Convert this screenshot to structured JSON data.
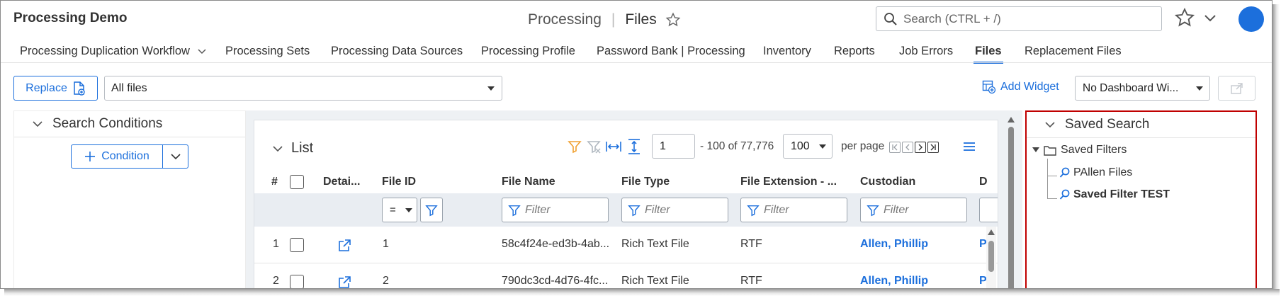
{
  "app": {
    "title": "Processing Demo"
  },
  "breadcrumb": {
    "parent": "Processing",
    "current": "Files"
  },
  "search": {
    "placeholder": "Search (CTRL + /)"
  },
  "tabs": [
    {
      "label": "Processing Duplication Workflow",
      "has_dropdown": true
    },
    {
      "label": "Processing Sets"
    },
    {
      "label": "Processing Data Sources"
    },
    {
      "label": "Processing Profile"
    },
    {
      "label": "Password Bank | Processing"
    },
    {
      "label": "Inventory"
    },
    {
      "label": "Reports"
    },
    {
      "label": "Job Errors"
    },
    {
      "label": "Files",
      "active": true
    },
    {
      "label": "Replacement Files"
    }
  ],
  "toolbar": {
    "replace_label": "Replace",
    "view_select": "All files",
    "add_widget_label": "Add Widget",
    "dashboard_select": "No Dashboard Wi..."
  },
  "search_conditions": {
    "title": "Search Conditions",
    "condition_label": "Condition"
  },
  "list": {
    "title": "List",
    "page": "1",
    "range_text": "- 100 of 77,776",
    "per_page": "100",
    "per_page_label": "per page",
    "columns": [
      "#",
      "Detai...",
      "File ID",
      "File Name",
      "File Type",
      "File Extension - ...",
      "Custodian",
      "D"
    ],
    "filter_placeholder": "Filter",
    "operator": "=",
    "rows": [
      {
        "num": "1",
        "file_id": "1",
        "file_name": "58c4f24e-ed3b-4ab...",
        "file_type": "Rich Text File",
        "ext": "RTF",
        "custodian": "Allen, Phillip",
        "d": "P"
      },
      {
        "num": "2",
        "file_id": "2",
        "file_name": "790dc3cd-4d76-4fc...",
        "file_type": "Rich Text File",
        "ext": "RTF",
        "custodian": "Allen, Phillip",
        "d": "P"
      }
    ]
  },
  "saved_search": {
    "title": "Saved Search",
    "folder": "Saved Filters",
    "items": [
      {
        "label": "PAllen Files"
      },
      {
        "label": "Saved Filter TEST",
        "bold": true
      }
    ]
  },
  "colors": {
    "accent": "#1c6fdc",
    "highlight_border": "#c00000",
    "filter_icon": "#f0a030"
  }
}
